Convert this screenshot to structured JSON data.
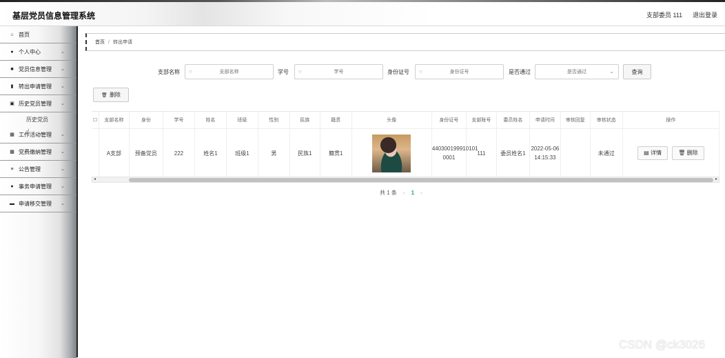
{
  "header": {
    "title": "基层党员信息管理系统",
    "user": "支部委员 111",
    "logout": "退出登录"
  },
  "sidebar": {
    "items": [
      {
        "label": "首页",
        "icon": "home-icon",
        "glyph": "⌂",
        "chevron": false
      },
      {
        "label": "个人中心",
        "icon": "user-icon",
        "glyph": "●",
        "chevron": true
      },
      {
        "label": "党员信息管理",
        "icon": "card-icon",
        "glyph": "■",
        "chevron": true
      },
      {
        "label": "转出申请管理",
        "icon": "chart-icon",
        "glyph": "▮",
        "chevron": true
      },
      {
        "label": "历史党员管理",
        "icon": "doc-icon",
        "glyph": "▣",
        "chevron": true
      }
    ],
    "submenu": {
      "label": "历史党员"
    },
    "items2": [
      {
        "label": "工作活动管理",
        "icon": "grid-icon",
        "glyph": "▦",
        "chevron": true
      },
      {
        "label": "党费缴纳管理",
        "icon": "grid-icon",
        "glyph": "▦",
        "chevron": true
      },
      {
        "label": "公告管理",
        "icon": "list-icon",
        "glyph": "≡",
        "chevron": true
      },
      {
        "label": "事务申请管理",
        "icon": "pin-icon",
        "glyph": "●",
        "chevron": true
      },
      {
        "label": "申请移交管理",
        "icon": "monitor-icon",
        "glyph": "▬",
        "chevron": true
      }
    ]
  },
  "breadcrumb": {
    "home": "首页",
    "sep": "/",
    "current": "转出申请"
  },
  "search": {
    "branch_label": "支部名称",
    "branch_placeholder": "支部名称",
    "id_label": "学号",
    "id_placeholder": "学号",
    "idcard_label": "身份证号",
    "idcard_placeholder": "身份证号",
    "pass_label": "是否通过",
    "pass_placeholder": "是否通过",
    "query_button": "查询"
  },
  "toolbar": {
    "delete_label": "删除"
  },
  "table": {
    "columns": [
      "支部名称",
      "身份",
      "学号",
      "姓名",
      "班级",
      "性别",
      "民族",
      "籍贯",
      "头像",
      "身份证号",
      "支部账号",
      "委员姓名",
      "申请时间",
      "审核回复",
      "审核状态",
      "操作"
    ],
    "rows": [
      {
        "cells": [
          "A支部",
          "预备党员",
          "222",
          "姓名1",
          "班级1",
          "男",
          "民族1",
          "籍贯1",
          "",
          "440300199910101 0001",
          "111",
          "委员姓名1",
          "2022-05-06 14:15:33",
          "",
          "未通过"
        ],
        "actions": {
          "detail": "详情",
          "delete": "删除"
        }
      }
    ]
  },
  "pagination": {
    "total": "共 1 条",
    "prev": "‹",
    "page": "1",
    "next": "›"
  },
  "watermark": "CSDN @ck3026",
  "colors": {
    "accent": "#2a9d8f"
  }
}
